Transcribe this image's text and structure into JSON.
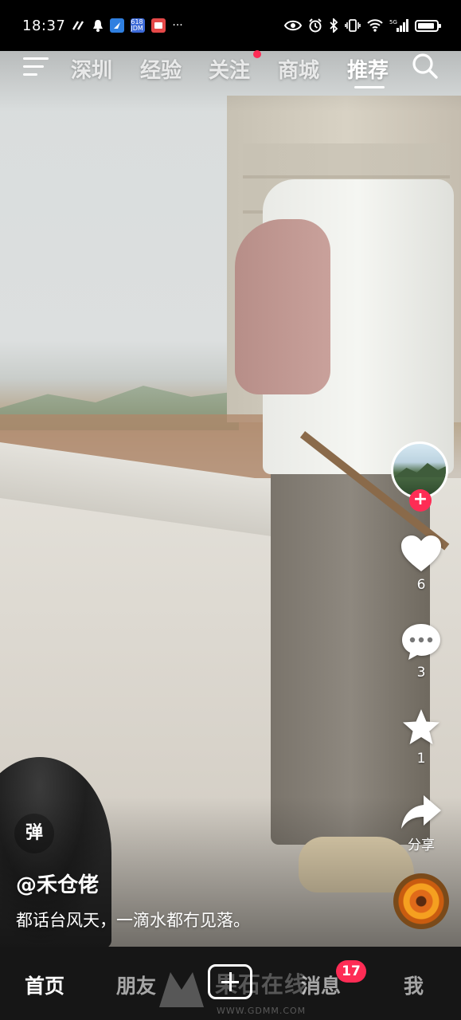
{
  "status_bar": {
    "time": "18:37",
    "left_icons": [
      "link-icon",
      "bell-icon",
      "app-icon",
      "jdm-app-icon",
      "app-red-icon",
      "more-dots"
    ],
    "jdm_text": "618 JDM",
    "more": "···",
    "network": "5G"
  },
  "top_tabs": {
    "items": [
      "深圳",
      "经验",
      "关注",
      "商城",
      "推荐"
    ],
    "active": "推荐"
  },
  "side_actions": {
    "like_count": "6",
    "comment_count": "3",
    "favorite_count": "1",
    "share_label": "分享",
    "follow_plus": "+"
  },
  "caption": {
    "danmu_label": "弹",
    "author": "@禾仓佬",
    "description": "都话台风天，一滴水都冇见落。"
  },
  "bottom_nav": {
    "home": "首页",
    "friends": "朋友",
    "messages": "消息",
    "messages_badge": "17",
    "me": "我"
  },
  "watermark": {
    "main": "果石在线",
    "sub": "WWW.GDMM.COM"
  },
  "colors": {
    "accent": "#fe2c55",
    "nav_bg": "#161616"
  }
}
